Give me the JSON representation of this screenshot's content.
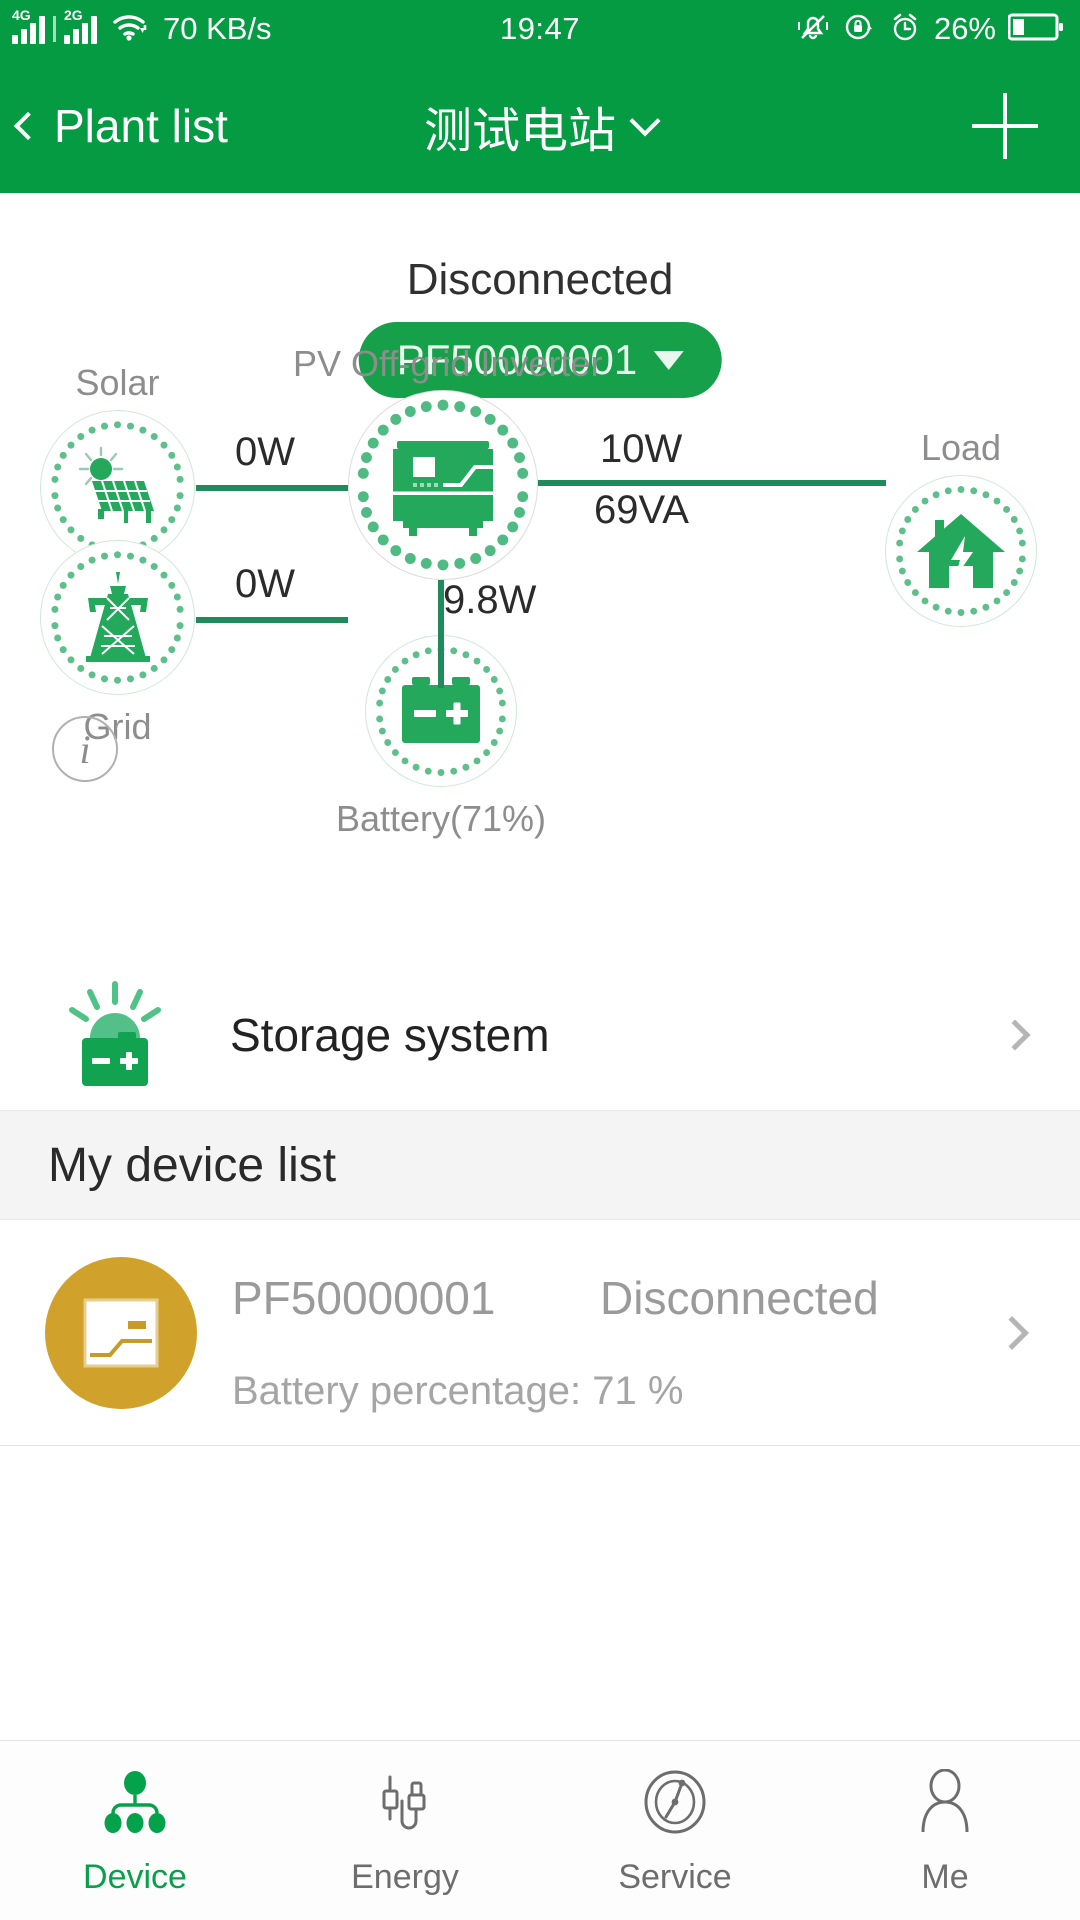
{
  "status_bar": {
    "network_1": "4G",
    "network_2": "2G",
    "wifi_icon": "wifi-icon",
    "net_speed": "70 KB/s",
    "time": "19:47",
    "mute_icon": "bell-muted-icon",
    "rotation_lock_icon": "rotation-lock-icon",
    "alarm_icon": "alarm-clock-icon",
    "battery_percent": "26%",
    "battery_icon": "battery-icon"
  },
  "app_bar": {
    "back_icon": "chevron-left-icon",
    "back_label": "Plant list",
    "title": "测试电站",
    "title_caret_icon": "chevron-down-icon",
    "add_icon": "plus-icon"
  },
  "overview": {
    "connection_status": "Disconnected",
    "device_selector": {
      "label": "PF50000001",
      "caret_icon": "caret-down-icon"
    },
    "info_icon": "info-icon"
  },
  "flow_diagram": {
    "nodes": {
      "solar": {
        "label": "Solar",
        "icon": "solar-panel-icon"
      },
      "grid": {
        "label": "Grid",
        "icon": "transmission-tower-icon"
      },
      "inverter": {
        "label": "PV Off-grid Inverter",
        "icon": "inverter-icon"
      },
      "load": {
        "label": "Load",
        "icon": "house-bolt-icon"
      },
      "battery": {
        "label": "Battery(71%)",
        "icon": "battery-cell-icon"
      }
    },
    "values": {
      "solar_to_inverter": "0W",
      "grid_to_inverter": "0W",
      "inverter_to_load_w": "10W",
      "inverter_to_load_va": "69VA",
      "inverter_to_battery": "9.8W"
    }
  },
  "storage_row": {
    "icon": "storage-battery-icon",
    "title": "Storage system",
    "chevron_icon": "chevron-right-icon"
  },
  "device_list": {
    "section_title": "My device list",
    "items": [
      {
        "avatar_icon": "inverter-avatar-icon",
        "avatar_color": "#D1A22B",
        "name": "PF50000001",
        "state": "Disconnected",
        "sub": "Battery percentage: 71 %",
        "chevron_icon": "chevron-right-icon"
      }
    ]
  },
  "bottom_nav": {
    "items": [
      {
        "label": "Device",
        "icon": "device-tree-icon",
        "active": true
      },
      {
        "label": "Energy",
        "icon": "plug-cable-icon",
        "active": false
      },
      {
        "label": "Service",
        "icon": "radar-dial-icon",
        "active": false
      },
      {
        "label": "Me",
        "icon": "person-icon",
        "active": false
      }
    ]
  },
  "colors": {
    "brand_green": "#059B43",
    "pill_green": "#17A04A",
    "icon_green": "#2FAE63",
    "line_green": "#1F8A5B",
    "avatar_gold": "#D1A22B"
  }
}
